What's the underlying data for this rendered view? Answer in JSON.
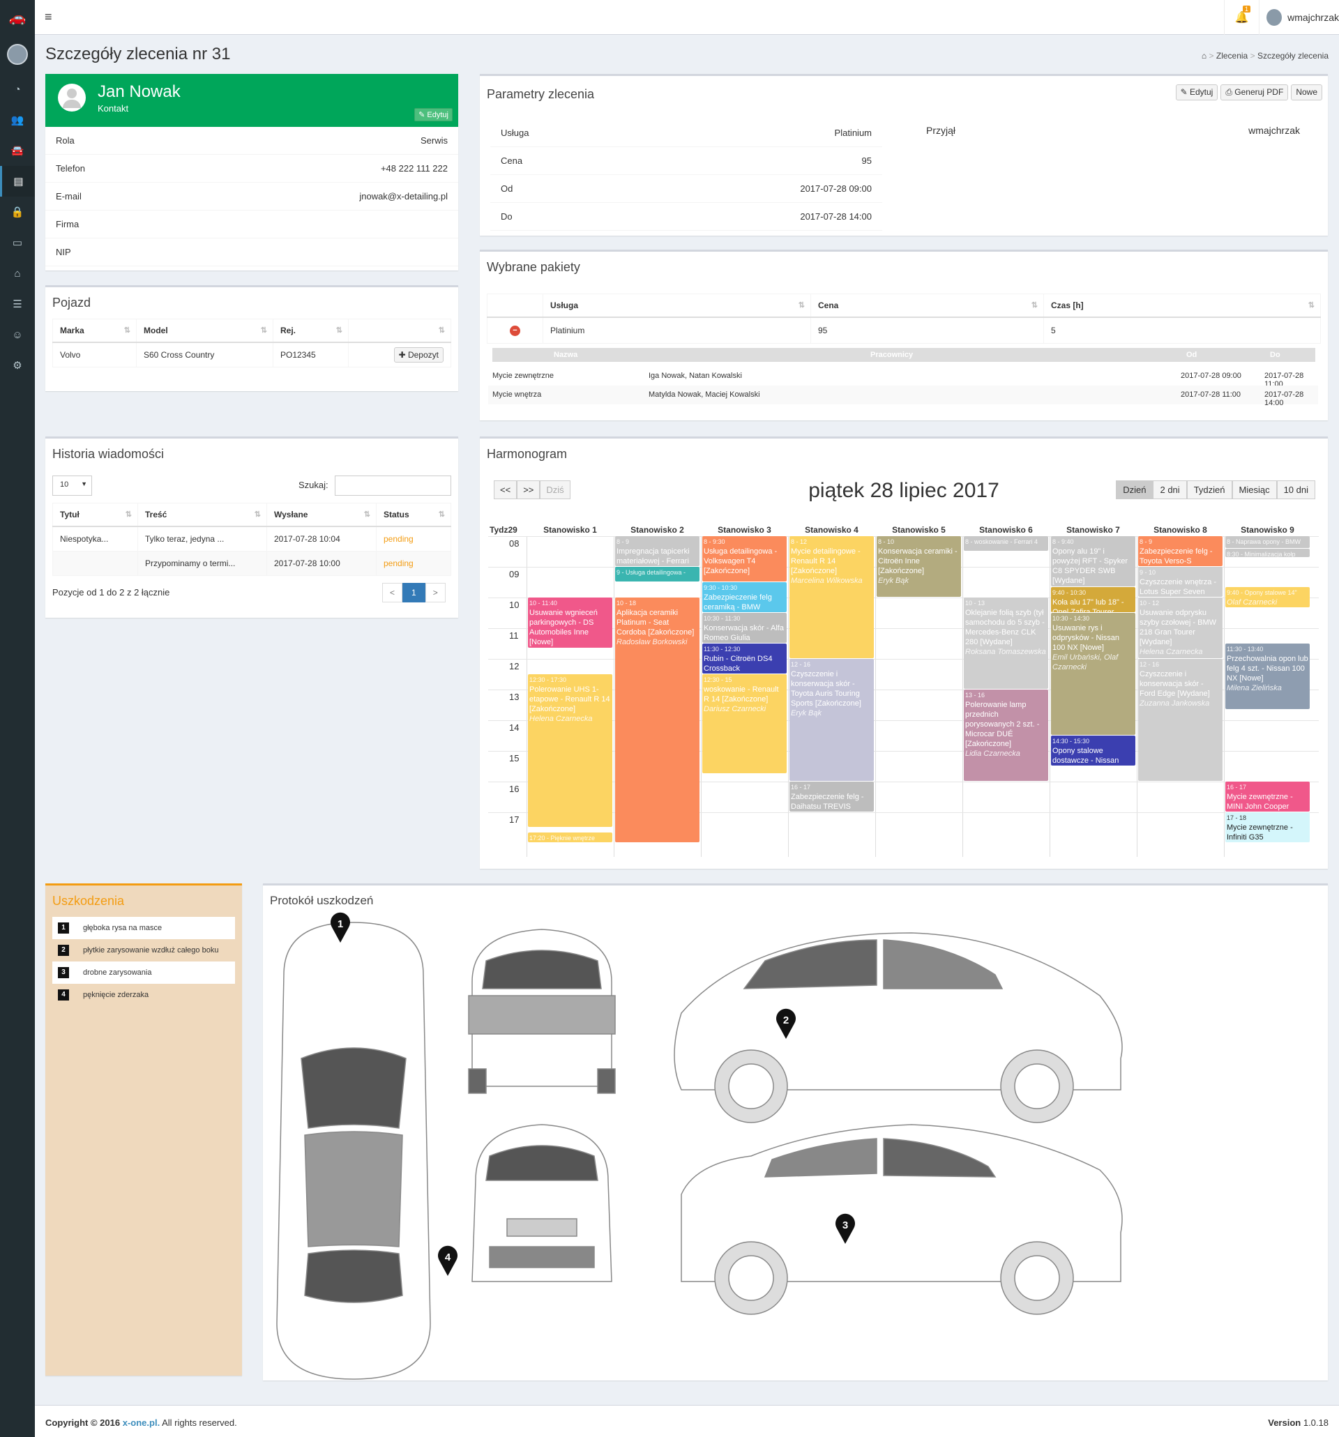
{
  "header": {
    "user": "wmajchrzak",
    "bell_count": "1"
  },
  "page": {
    "title": "Szczegóły zlecenia nr 31",
    "breadcrumb": [
      "Zlecenia",
      "Szczegóły zlecenia"
    ]
  },
  "contact": {
    "name": "Jan Nowak",
    "subtitle": "Kontakt",
    "edit": "Edytuj",
    "rows": [
      {
        "k": "Rola",
        "v": "Serwis"
      },
      {
        "k": "Telefon",
        "v": "+48 222 111 222"
      },
      {
        "k": "E-mail",
        "v": "jnowak@x-detailing.pl"
      },
      {
        "k": "Firma",
        "v": ""
      },
      {
        "k": "NIP",
        "v": ""
      }
    ]
  },
  "vehicle": {
    "title": "Pojazd",
    "headers": [
      "Marka",
      "Model",
      "Rej.",
      ""
    ],
    "row": [
      "Volvo",
      "S60 Cross Country",
      "PO12345"
    ],
    "deposit": "Depozyt"
  },
  "messages": {
    "title": "Historia wiadomości",
    "page_size": "10",
    "search_label": "Szukaj:",
    "headers": [
      "Tytuł",
      "Treść",
      "Wysłane",
      "Status"
    ],
    "rows": [
      [
        "Niespotyka...",
        "Tylko teraz, jedyna ...",
        "2017-07-28 10:04",
        "pending"
      ],
      [
        "",
        "Przypominamy o termi...",
        "2017-07-28 10:00",
        "pending"
      ]
    ],
    "info": "Pozycje od 1 do 2 z 2 łącznie",
    "prev": "<",
    "page": "1",
    "next": ">"
  },
  "params": {
    "title": "Parametry zlecenia",
    "btn_edit": "Edytuj",
    "btn_pdf": "Generuj PDF",
    "btn_new": "Nowe",
    "rows": [
      {
        "k": "Usługa",
        "v": "Platinium"
      },
      {
        "k": "Cena",
        "v": "95"
      },
      {
        "k": "Od",
        "v": "2017-07-28 09:00"
      },
      {
        "k": "Do",
        "v": "2017-07-28 14:00"
      }
    ],
    "received_label": "Przyjął",
    "received_value": "wmajchrzak"
  },
  "packages": {
    "title": "Wybrane pakiety",
    "headers": [
      "Usługa",
      "Cena",
      "Czas [h]"
    ],
    "row": [
      "Platinium",
      "95",
      "5"
    ],
    "sub_headers": [
      "Nazwa",
      "Pracownicy",
      "Od",
      "Do"
    ],
    "sub_rows": [
      [
        "Mycie zewnętrzne",
        "Iga Nowak, Natan Kowalski",
        "2017-07-28 09:00",
        "2017-07-28 11:00"
      ],
      [
        "Mycie wnętrza",
        "Matylda Nowak, Maciej Kowalski",
        "2017-07-28 11:00",
        "2017-07-28 14:00"
      ]
    ]
  },
  "schedule": {
    "title": "Harmonogram",
    "date": "piątek 28 lipiec 2017",
    "nav": [
      "<<",
      ">>",
      "Dziś"
    ],
    "views": [
      "Dzień",
      "2 dni",
      "Tydzień",
      "Miesiąc",
      "10 dni"
    ],
    "week": "Tydz29",
    "stations": [
      "Stanowisko 1",
      "Stanowisko 2",
      "Stanowisko 3",
      "Stanowisko 4",
      "Stanowisko 5",
      "Stanowisko 6",
      "Stanowisko 7",
      "Stanowisko 8",
      "Stanowisko 9"
    ],
    "hours": [
      "08",
      "09",
      "10",
      "11",
      "12",
      "13",
      "14",
      "15",
      "16",
      "17"
    ],
    "events": [
      {
        "c": 0,
        "s": 10,
        "e": 11.67,
        "color": "#f0588a",
        "time": "10 - 11:40",
        "title": "Usuwanie wgnieceń parkingowych - DS Automobiles Inne [Nowe]",
        "person": ""
      },
      {
        "c": 0,
        "s": 12.5,
        "e": 17.5,
        "color": "#fcd462",
        "time": "12:30 - 17:30",
        "title": "Polerowanie UHS 1-etapowe - Renault R 14 [Zakończone]",
        "person": "Helena Czarnecka"
      },
      {
        "c": 0,
        "s": 17.67,
        "e": 18,
        "color": "#fcd462",
        "time": "17:20 - Pięknie wnętrze",
        "title": "",
        "person": ""
      },
      {
        "c": 1,
        "s": 8,
        "e": 9,
        "color": "#c8c8c8",
        "time": "8 - 9",
        "title": "Impregnacja tapicerki materiałowej - Ferrari",
        "person": ""
      },
      {
        "c": 1,
        "s": 9,
        "e": 9.5,
        "color": "#3ab5b0",
        "time": "9 - Usługa detailingowa -",
        "title": "",
        "person": ""
      },
      {
        "c": 1,
        "s": 10,
        "e": 18,
        "color": "#fb8b5c",
        "time": "10 - 18",
        "title": "Aplikacja ceramiki Platinum - Seat Cordoba [Zakończone]",
        "person": "Radosław Borkowski"
      },
      {
        "c": 2,
        "s": 8,
        "e": 9.5,
        "color": "#fb8b5c",
        "time": "8 - 9:30",
        "title": "Usługa detailingowa - Volkswagen T4 [Zakończone]",
        "person": ""
      },
      {
        "c": 2,
        "s": 9.5,
        "e": 10.5,
        "color": "#5bc8ec",
        "time": "9:30 - 10:30",
        "title": "Zabezpieczenie felg ceramiką - BMW",
        "person": ""
      },
      {
        "c": 2,
        "s": 10.5,
        "e": 11.5,
        "color": "#bdbdbd",
        "time": "10:30 - 11:30",
        "title": "Konserwacja skór - Alfa Romeo Giulia",
        "person": ""
      },
      {
        "c": 2,
        "s": 11.5,
        "e": 12.5,
        "color": "#3b3fb0",
        "time": "11:30 - 12:30",
        "title": "Rubin - Citroën DS4 Crossback",
        "person": ""
      },
      {
        "c": 2,
        "s": 12.5,
        "e": 15.75,
        "color": "#fcd462",
        "time": "12:30 - 15",
        "title": "woskowanie - Renault R 14 [Zakończone]",
        "person": "Dariusz Czarnecki"
      },
      {
        "c": 3,
        "s": 8,
        "e": 12,
        "color": "#fcd462",
        "time": "8 - 12",
        "title": "Mycie detailingowe - Renault R 14 [Zakończone]",
        "person": "Marcelina Wilkowska"
      },
      {
        "c": 3,
        "s": 12,
        "e": 16,
        "color": "#c4c4d8",
        "time": "12 - 16",
        "title": "Czyszczenie i konserwacja skór - Toyota Auris Touring Sports [Zakończone]",
        "person": "Eryk Bąk"
      },
      {
        "c": 3,
        "s": 16,
        "e": 17,
        "color": "#bdbdbd",
        "time": "16 - 17",
        "title": "Zabezpieczenie felg - Daihatsu TREVIS",
        "person": ""
      },
      {
        "c": 4,
        "s": 8,
        "e": 10,
        "color": "#b3ab7f",
        "time": "8 - 10",
        "title": "Konserwacja ceramiki - Citroën Inne [Zakończone]",
        "person": "Eryk Bąk"
      },
      {
        "c": 5,
        "s": 8,
        "e": 8.5,
        "color": "#c8c8c8",
        "time": "8 - woskowanie - Ferrari 4",
        "title": "",
        "person": ""
      },
      {
        "c": 5,
        "s": 10,
        "e": 13,
        "color": "#cfcfcf",
        "time": "10 - 13",
        "title": "Oklejanie folią szyb (tył samochodu do 5 szyb - Mercedes-Benz CLK 280 [Wydane]",
        "person": "Roksana Tomaszewska"
      },
      {
        "c": 5,
        "s": 13,
        "e": 16,
        "color": "#c291a8",
        "time": "13 - 16",
        "title": "Polerowanie lamp przednich porysowanych 2 szt. - Microcar DUÉ [Zakończone]",
        "person": "Lidia Czarnecka"
      },
      {
        "c": 6,
        "s": 8,
        "e": 9.67,
        "color": "#c8c8c8",
        "time": "8 - 9:40",
        "title": "Opony alu 19\" i powyżej RFT - Spyker C8 SPYDER SWB [Wydane]",
        "person": ""
      },
      {
        "c": 6,
        "s": 9.67,
        "e": 10.5,
        "color": "#d4a93a",
        "time": "9:40 - 10:30",
        "title": "Koła alu 17\" lub 18\" - Opel Zafira Tourer",
        "person": ""
      },
      {
        "c": 6,
        "s": 10.5,
        "e": 14.5,
        "color": "#b3ab7f",
        "time": "10:30 - 14:30",
        "title": "Usuwanie rys i odprysków - Nissan 100 NX [Nowe]",
        "person": "Emil Urbański, Olaf Czarnecki"
      },
      {
        "c": 6,
        "s": 14.5,
        "e": 15.5,
        "color": "#3b3fb0",
        "time": "14:30 - 15:30",
        "title": "Opony stalowe dostawcze - Nissan",
        "person": ""
      },
      {
        "c": 7,
        "s": 8,
        "e": 9,
        "color": "#fb8b5c",
        "time": "8 - 9",
        "title": "Zabezpieczenie felg - Toyota Verso-S",
        "person": ""
      },
      {
        "c": 7,
        "s": 9,
        "e": 10,
        "color": "#cfcfcf",
        "time": "9 - 10",
        "title": "Czyszczenie wnętrza - Lotus Super Seven",
        "person": ""
      },
      {
        "c": 7,
        "s": 10,
        "e": 12,
        "color": "#cfcfcf",
        "time": "10 - 12",
        "title": "Usuwanie odprysku szyby czołowej - BMW 218 Gran Tourer [Wydane]",
        "person": "Helena Czarnecka"
      },
      {
        "c": 7,
        "s": 12,
        "e": 16,
        "color": "#cfcfcf",
        "time": "12 - 16",
        "title": "Czyszczenie i konserwacja skór - Ford Edge [Wydane]",
        "person": "Zuzanna Jankowska"
      },
      {
        "c": 8,
        "s": 8,
        "e": 8.4,
        "color": "#c8c8c8",
        "time": "8 - Naprawa opony - BMW",
        "title": "",
        "person": ""
      },
      {
        "c": 8,
        "s": 8.4,
        "e": 8.7,
        "color": "#c8c8c8",
        "time": "8:30 - Minimalizacja kołp",
        "title": "",
        "person": ""
      },
      {
        "c": 8,
        "s": 9.67,
        "e": 10.33,
        "color": "#fcd462",
        "time": "9:40 - Opony stalowe 14\"",
        "title": "",
        "person": "Olaf Czarnecki"
      },
      {
        "c": 8,
        "s": 11.5,
        "e": 13.67,
        "color": "#8e9db0",
        "time": "11:30 - 13:40",
        "title": "Przechowalnia opon lub felg 4 szt. - Nissan 100 NX [Nowe]",
        "person": "Milena Zielińska"
      },
      {
        "c": 8,
        "s": 16,
        "e": 17,
        "color": "#f0588a",
        "time": "16 - 17",
        "title": "Mycie zewnętrzne - MINI John Cooper",
        "person": ""
      },
      {
        "c": 8,
        "s": 17,
        "e": 18,
        "color": "#d4f6fb",
        "time": "17 - 18",
        "title": "Mycie zewnętrzne - Infiniti G35",
        "person": "",
        "dark": true
      }
    ]
  },
  "damages": {
    "title": "Uszkodzenia",
    "items": [
      "głęboka rysa na masce",
      "płytkie zarysowanie wzdłuż całego boku",
      "drobne zarysowania",
      "pęknięcie zderzaka"
    ]
  },
  "protocol": {
    "title": "Protokół uszkodzeń",
    "pins": [
      "1",
      "2",
      "3",
      "4"
    ]
  },
  "footer": {
    "copy_prefix": "Copyright © 2016",
    "brand": "x-one.pl.",
    "copy_suffix": "All rights reserved.",
    "version_label": "Version",
    "version": "1.0.18"
  }
}
